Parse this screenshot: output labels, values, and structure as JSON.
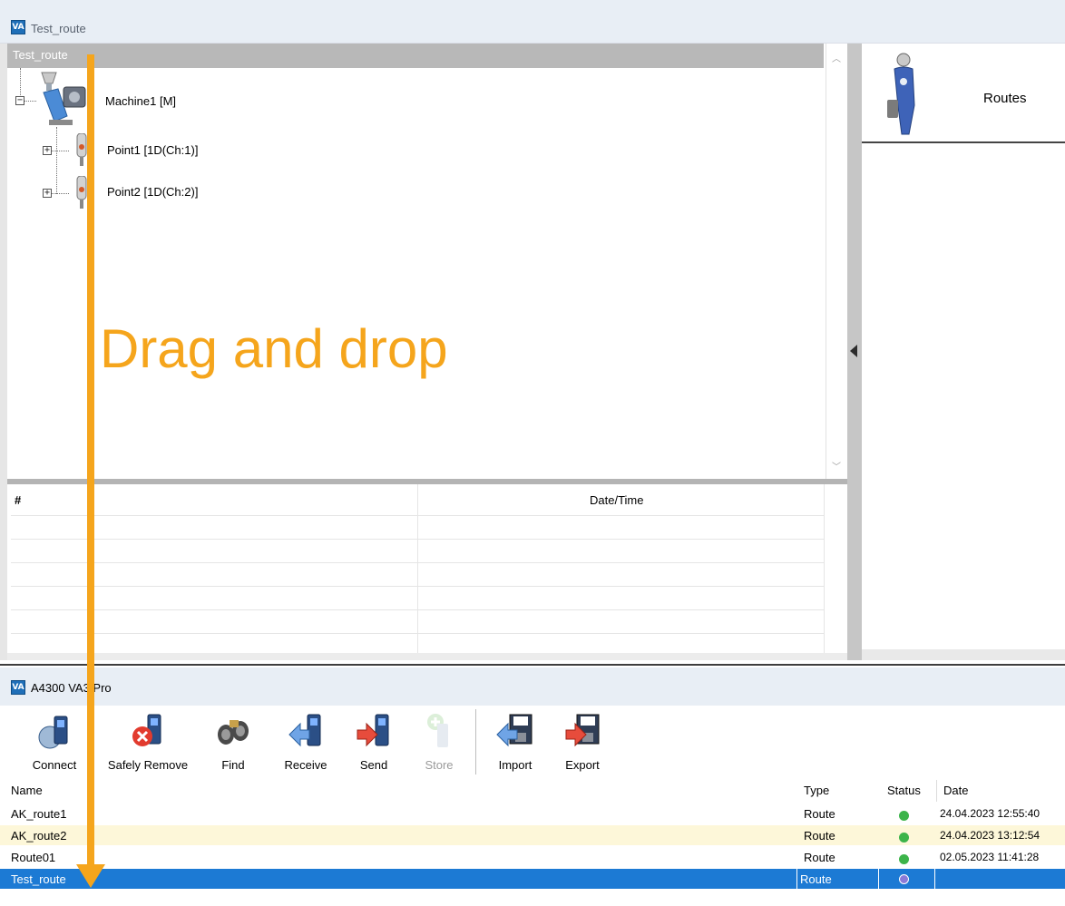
{
  "top_window": {
    "title": "Test_route",
    "tree": {
      "root": "Test_route",
      "machine": "Machine1 [M]",
      "points": [
        "Point1 [1D(Ch:1)]",
        "Point2 [1D(Ch:2)]"
      ]
    },
    "grid": {
      "columns": [
        "#",
        "Date/Time"
      ]
    },
    "routes_panel": {
      "title": "Routes"
    }
  },
  "bottom_window": {
    "title": "A4300 VA3 Pro",
    "toolbar": [
      {
        "label": "Connect",
        "icon": "connect-icon",
        "enabled": true
      },
      {
        "label": "Safely Remove",
        "icon": "safely-remove-icon",
        "enabled": true
      },
      {
        "label": "Find",
        "icon": "binoculars-icon",
        "enabled": true
      },
      {
        "label": "Receive",
        "icon": "receive-icon",
        "enabled": true
      },
      {
        "label": "Send",
        "icon": "send-icon",
        "enabled": true
      },
      {
        "label": "Store",
        "icon": "store-icon",
        "enabled": false
      },
      {
        "label": "Import",
        "icon": "import-icon",
        "enabled": true
      },
      {
        "label": "Export",
        "icon": "export-icon",
        "enabled": true
      }
    ],
    "list": {
      "columns": [
        "Name",
        "Type",
        "Status",
        "Date"
      ],
      "rows": [
        {
          "name": "AK_route1",
          "type": "Route",
          "status": "ok",
          "date": "24.04.2023 12:55:40"
        },
        {
          "name": "AK_route2",
          "type": "Route",
          "status": "ok",
          "date": "24.04.2023 13:12:54"
        },
        {
          "name": "Route01",
          "type": "Route",
          "status": "ok",
          "date": "02.05.2023 11:41:28"
        },
        {
          "name": "Test_route",
          "type": "Route",
          "status": "pending",
          "date": ""
        }
      ]
    }
  },
  "overlay": {
    "label": "Drag and drop"
  },
  "colors": {
    "accent": "#f5a51c",
    "selection": "#1c7ad4",
    "highlight_row": "#fdf7d9",
    "status_ok": "#3cb44a",
    "status_pending": "#8a7ad8"
  }
}
